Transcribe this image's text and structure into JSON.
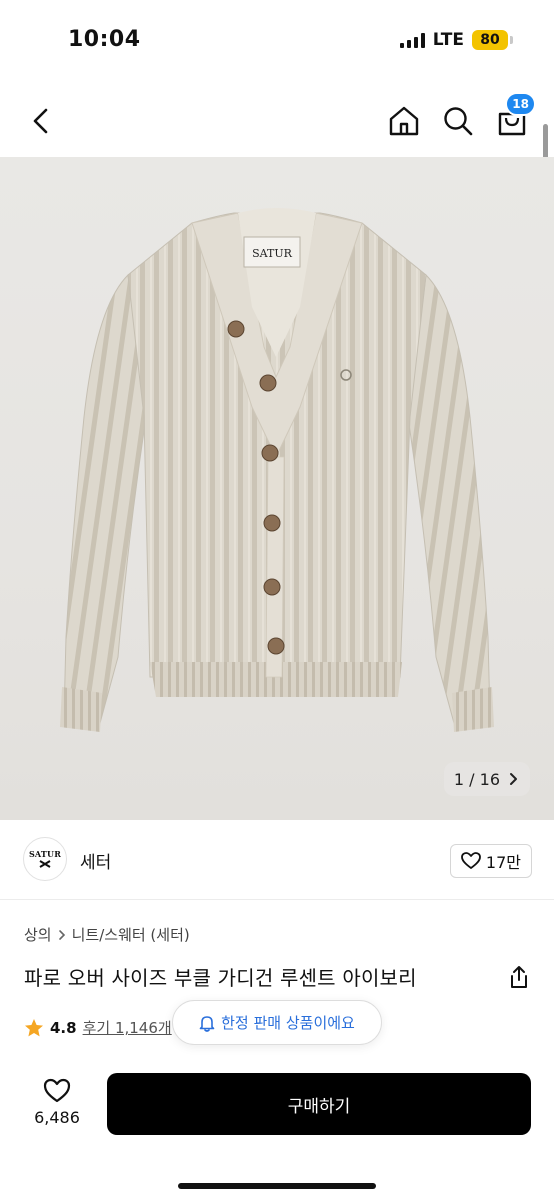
{
  "status": {
    "time": "10:04",
    "network": "LTE",
    "battery": "80"
  },
  "nav": {
    "cart_count": "18"
  },
  "image": {
    "counter": "1 / 16",
    "label_text": "SATUR"
  },
  "brand": {
    "logo_text": "SATUR",
    "name": "세터",
    "likes": "17만"
  },
  "product": {
    "breadcrumb": [
      "상의",
      "니트/스웨터 (세터)"
    ],
    "title": "파로 오버 사이즈 부클 가디건 루센트 아이보리",
    "rating": "4.8",
    "reviews": "후기 1,146개"
  },
  "toast": {
    "text": "한정 판매 상품이에요"
  },
  "bottom": {
    "like_count": "6,486",
    "buy_label": "구매하기"
  }
}
